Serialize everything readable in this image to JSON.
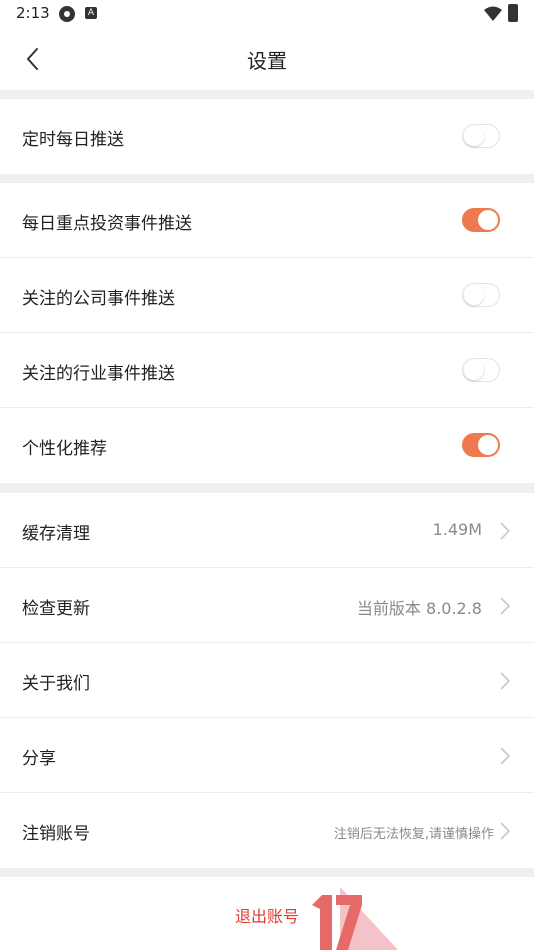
{
  "status": {
    "time": "2:13",
    "notif_a": "A"
  },
  "header": {
    "title": "设置"
  },
  "groups": {
    "g1": [
      {
        "label": "定时每日推送",
        "toggle": false
      }
    ],
    "g2": [
      {
        "label": "每日重点投资事件推送",
        "toggle": true
      },
      {
        "label": "关注的公司事件推送",
        "toggle": false
      },
      {
        "label": "关注的行业事件推送",
        "toggle": false
      },
      {
        "label": "个性化推荐",
        "toggle": true
      }
    ],
    "g3": [
      {
        "label": "缓存清理",
        "value": "1.49M"
      },
      {
        "label": "检查更新",
        "value": "当前版本 8.0.2.8"
      },
      {
        "label": "关于我们",
        "value": ""
      },
      {
        "label": "分享",
        "value": ""
      },
      {
        "label": "注销账号",
        "value": "注销后无法恢复,请谨慎操作"
      }
    ]
  },
  "logout": {
    "label": "退出账号"
  },
  "colors": {
    "accent": "#f07a4f",
    "danger": "#e23a2e",
    "divider": "#efefef"
  },
  "icons": {
    "back": "chevron-left-icon",
    "arrow": "chevron-right-icon"
  }
}
